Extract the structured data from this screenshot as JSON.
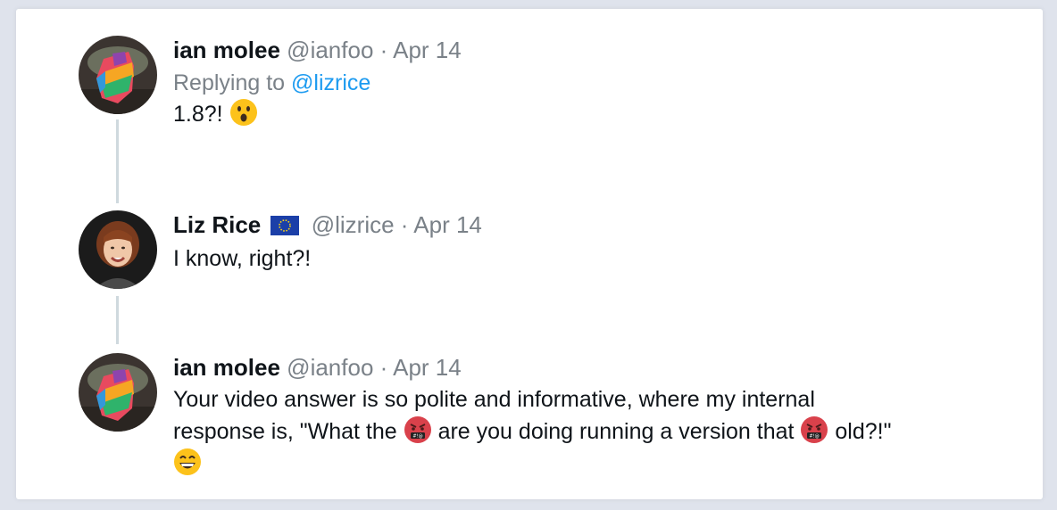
{
  "tweets": [
    {
      "name": "ian molee",
      "handle": "@ianfoo",
      "separator": "·",
      "date": "Apr 14",
      "replying_prefix": "Replying to",
      "replying_to": "@lizrice",
      "text": "1.8?!",
      "emoji": "astonished-face-icon"
    },
    {
      "name": "Liz Rice",
      "flag": "eu-flag-icon",
      "handle": "@lizrice",
      "separator": "·",
      "date": "Apr 14",
      "text": "I know, right?!"
    },
    {
      "name": "ian molee",
      "handle": "@ianfoo",
      "separator": "·",
      "date": "Apr 14",
      "text_line1": "Your video answer is so polite and informative, where my internal",
      "text_line2_a": "response is, \"What the",
      "text_line2_b": "are you doing running a version that",
      "text_line2_c": "old?!\"",
      "emojis": [
        "cursing-face-icon",
        "cursing-face-icon",
        "grinning-face-icon"
      ]
    }
  ],
  "colors": {
    "link": "#1d9bf0",
    "muted": "#7a8188",
    "thread_line": "#cfd9de"
  }
}
